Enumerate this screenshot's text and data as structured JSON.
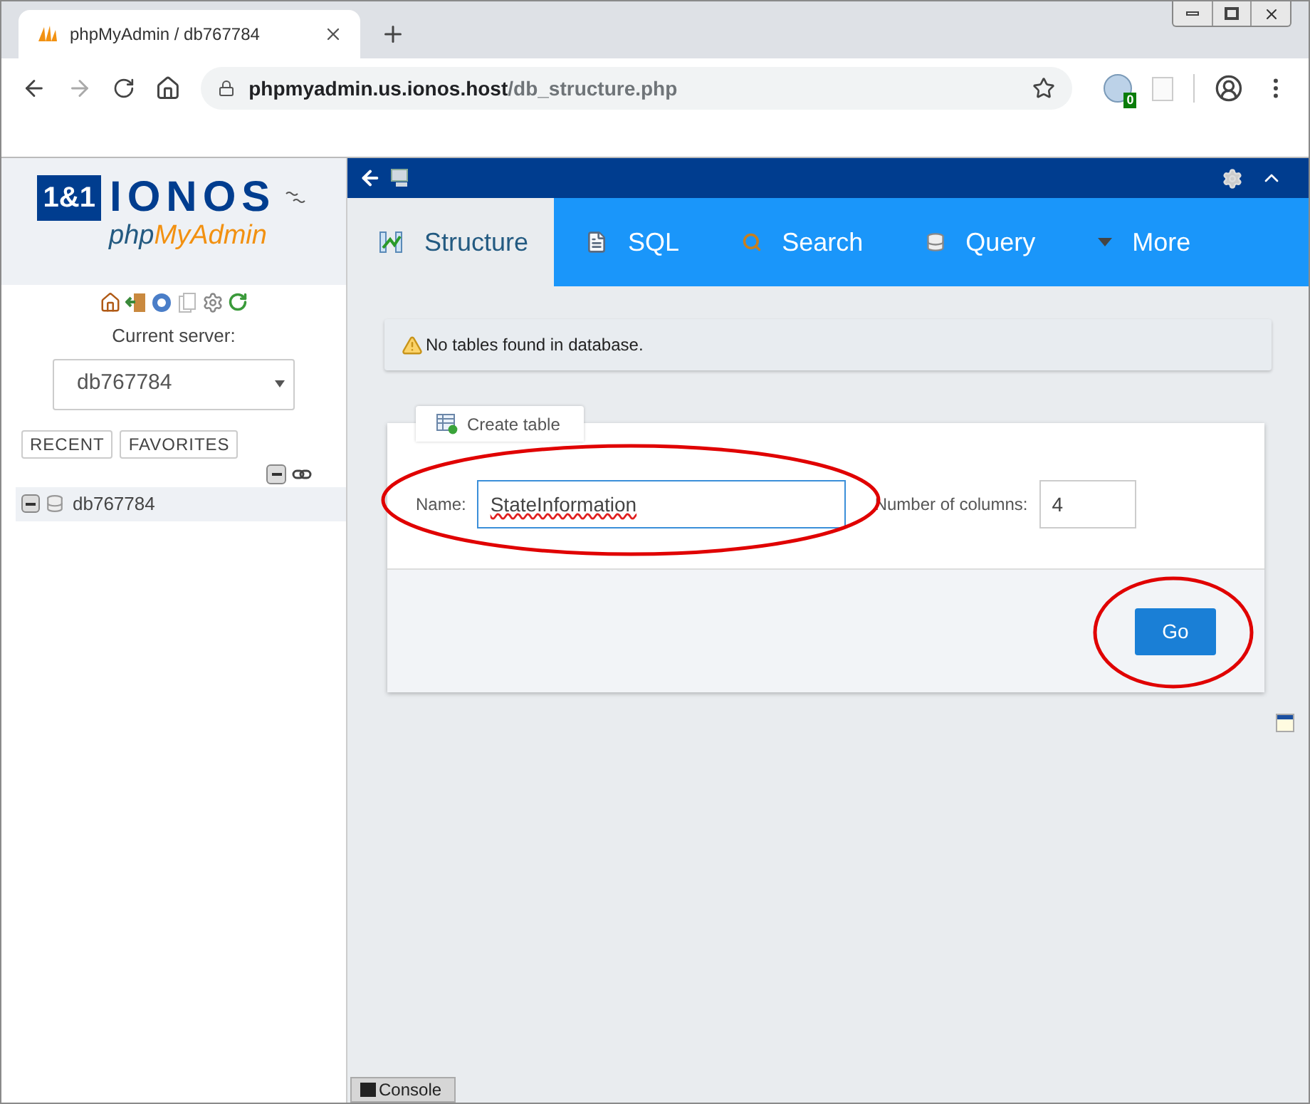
{
  "browser": {
    "tab_title": "phpMyAdmin / db767784",
    "url_host": "phpmyadmin.us.ionos.host",
    "url_path": "/db_structure.php",
    "extension_badge": "0"
  },
  "sidebar": {
    "logo": {
      "box": "1&1",
      "brand": "IONOS",
      "product_prefix": "php",
      "product_suffix": "MyAdmin"
    },
    "current_server_label": "Current server:",
    "server_value": "db767784",
    "nav_buttons": [
      "RECENT",
      "FAVORITES"
    ],
    "tree": [
      {
        "label": "db767784",
        "expanded": true
      }
    ]
  },
  "tabs": [
    {
      "label": "Structure",
      "selected": true
    },
    {
      "label": "SQL",
      "selected": false
    },
    {
      "label": "Search",
      "selected": false
    },
    {
      "label": "Query",
      "selected": false
    },
    {
      "label": "More",
      "selected": false
    }
  ],
  "notice": "No tables found in database.",
  "create_table": {
    "legend": "Create table",
    "name_label": "Name:",
    "name_value": "StateInformation",
    "columns_label": "Number of columns:",
    "columns_value": "4",
    "submit": "Go"
  },
  "console_label": "Console"
}
